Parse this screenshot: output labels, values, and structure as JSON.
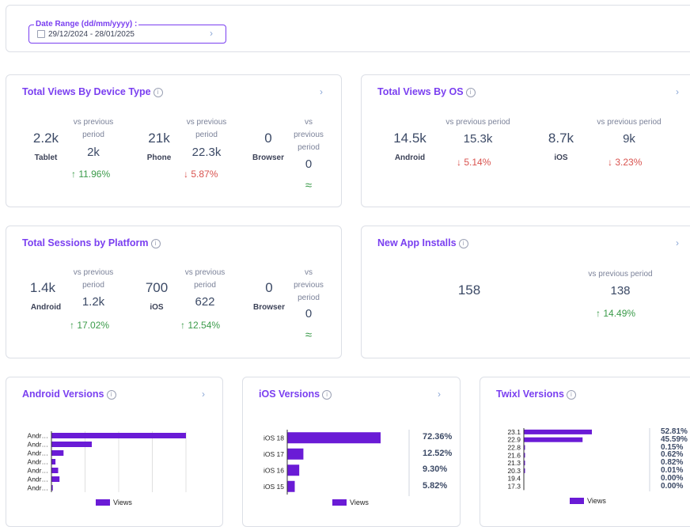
{
  "date_range": {
    "label": "Date Range (dd/mm/yyyy) :",
    "value": "29/12/2024 - 28/01/2025"
  },
  "device_type": {
    "title": "Total Views By Device Type",
    "items": [
      {
        "value": "2.2k",
        "label": "Tablet",
        "vs": "vs previous period",
        "prev": "2k",
        "change": "11.96%",
        "dir": "up"
      },
      {
        "value": "21k",
        "label": "Phone",
        "vs": "vs previous period",
        "prev": "22.3k",
        "change": "5.87%",
        "dir": "down"
      },
      {
        "value": "0",
        "label": "Browser",
        "vs": "vs previous period",
        "prev": "0",
        "change": "≈",
        "dir": "eq"
      }
    ]
  },
  "os": {
    "title": "Total Views By OS",
    "items": [
      {
        "value": "14.5k",
        "label": "Android",
        "vs": "vs previous period",
        "prev": "15.3k",
        "change": "5.14%",
        "dir": "down"
      },
      {
        "value": "8.7k",
        "label": "iOS",
        "vs": "vs previous period",
        "prev": "9k",
        "change": "3.23%",
        "dir": "down"
      }
    ]
  },
  "sessions": {
    "title": "Total Sessions by Platform",
    "items": [
      {
        "value": "1.4k",
        "label": "Android",
        "vs": "vs previous period",
        "prev": "1.2k",
        "change": "17.02%",
        "dir": "up"
      },
      {
        "value": "700",
        "label": "iOS",
        "vs": "vs previous period",
        "prev": "622",
        "change": "12.54%",
        "dir": "up"
      },
      {
        "value": "0",
        "label": "Browser",
        "vs": "vs previous period",
        "prev": "0",
        "change": "≈",
        "dir": "eq"
      }
    ]
  },
  "installs": {
    "title": "New App Installs",
    "value": "158",
    "vs": "vs previous period",
    "prev": "138",
    "change": "14.49%",
    "dir": "up"
  },
  "icons": {
    "up": "↑",
    "down": "↓",
    "chevron": "›",
    "info": "i"
  },
  "colors": {
    "accent": "#7a3ff0",
    "bar": "#6a1bd6",
    "up": "#3b9b4a",
    "down": "#d9534f"
  },
  "android_versions": {
    "title": "Android Versions",
    "legend": "Views"
  },
  "ios_versions": {
    "title": "iOS Versions",
    "legend": "Views"
  },
  "twixl_versions": {
    "title": "Twixl Versions",
    "legend": "Views"
  },
  "chart_data": [
    {
      "type": "bar",
      "orientation": "horizontal",
      "categories": [
        "Andr…",
        "Andr…",
        "Andr…",
        "Andr…",
        "Andr…",
        "Andr…",
        "Andr…"
      ],
      "values": [
        100,
        30,
        9,
        3,
        5,
        6,
        1
      ],
      "legend": "Views"
    },
    {
      "type": "bar",
      "orientation": "horizontal",
      "categories": [
        "iOS 18",
        "iOS 17",
        "iOS 16",
        "iOS 15"
      ],
      "values": [
        72.36,
        12.52,
        9.3,
        5.82
      ],
      "labels": [
        "72.36%",
        "12.52%",
        "9.30%",
        "5.82%"
      ],
      "legend": "Views"
    },
    {
      "type": "bar",
      "orientation": "horizontal",
      "categories": [
        "23.1",
        "22.9",
        "22.8",
        "21.6",
        "21.3",
        "20.3",
        "19.4",
        "17.3"
      ],
      "values": [
        52.81,
        45.59,
        0.15,
        0.62,
        0.82,
        0.01,
        0.0,
        0.0
      ],
      "labels": [
        "52.81%",
        "45.59%",
        "0.15%",
        "0.62%",
        "0.82%",
        "0.01%",
        "0.00%",
        "0.00%"
      ],
      "legend": "Views"
    }
  ]
}
